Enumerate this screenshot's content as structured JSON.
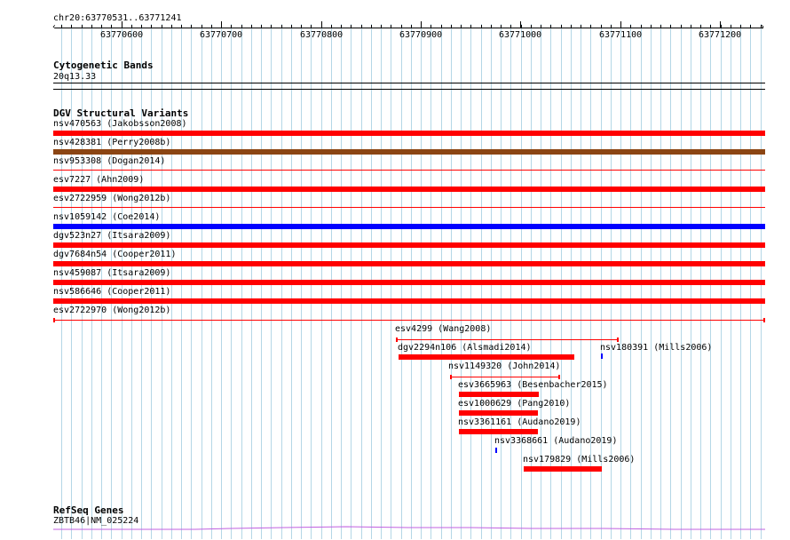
{
  "colors": {
    "grid_line": "#b4d7e6",
    "ruler": "#000000",
    "variant_red": "#ff0000",
    "variant_brown": "#8b4513",
    "variant_blue": "#0000ff",
    "gene_line": "#c060e0"
  },
  "ruler": {
    "label": "chr20:63770531..63771241",
    "ticks": [
      "63770600",
      "63770700",
      "63770800",
      "63770900",
      "63771000",
      "63771100",
      "63771200"
    ]
  },
  "cytoband": {
    "title": "Cytogenetic Bands",
    "band": "20q13.33"
  },
  "dgv": {
    "title": "DGV Structural Variants",
    "features": [
      {
        "label": "nsv470563 (Jakobsson2008)",
        "color": "red",
        "style": "thick"
      },
      {
        "label": "nsv428381 (Perry2008b)",
        "color": "brown",
        "style": "thick"
      },
      {
        "label": "nsv953308 (Dogan2014)",
        "color": "red",
        "style": "thin"
      },
      {
        "label": "esv7227 (Ahn2009)",
        "color": "red",
        "style": "thick"
      },
      {
        "label": "esv2722959 (Wong2012b)",
        "color": "red",
        "style": "thin"
      },
      {
        "label": "nsv1059142 (Coe2014)",
        "color": "blue",
        "style": "thick"
      },
      {
        "label": "dgv523n27 (Itsara2009)",
        "color": "red",
        "style": "thick"
      },
      {
        "label": "dgv7684n54 (Cooper2011)",
        "color": "red",
        "style": "thick"
      },
      {
        "label": "nsv459087 (Itsara2009)",
        "color": "red",
        "style": "thick"
      },
      {
        "label": "nsv586646 (Cooper2011)",
        "color": "red",
        "style": "thick"
      },
      {
        "label": "esv2722970 (Wong2012b)",
        "color": "red",
        "style": "bracket"
      },
      {
        "label": "esv4299 (Wang2008)",
        "color": "red",
        "style": "bracket"
      },
      {
        "label": "dgv2294n106 (Alsmadi2014)",
        "color": "red",
        "style": "thick"
      },
      {
        "label": "nsv180391 (Mills2006)",
        "color": "blue",
        "style": "tiny"
      },
      {
        "label": "nsv1149320 (John2014)",
        "color": "red",
        "style": "bracket"
      },
      {
        "label": "esv3665963 (Besenbacher2015)",
        "color": "red",
        "style": "thick"
      },
      {
        "label": "esv1000629 (Pang2010)",
        "color": "red",
        "style": "thick"
      },
      {
        "label": "nsv3361161 (Audano2019)",
        "color": "red",
        "style": "thick"
      },
      {
        "label": "nsv3368661 (Audano2019)",
        "color": "blue",
        "style": "tiny"
      },
      {
        "label": "nsv179829 (Mills2006)",
        "color": "red",
        "style": "thick"
      }
    ]
  },
  "refseq": {
    "title": "RefSeq Genes",
    "gene": "ZBTB46|NM_025224"
  }
}
